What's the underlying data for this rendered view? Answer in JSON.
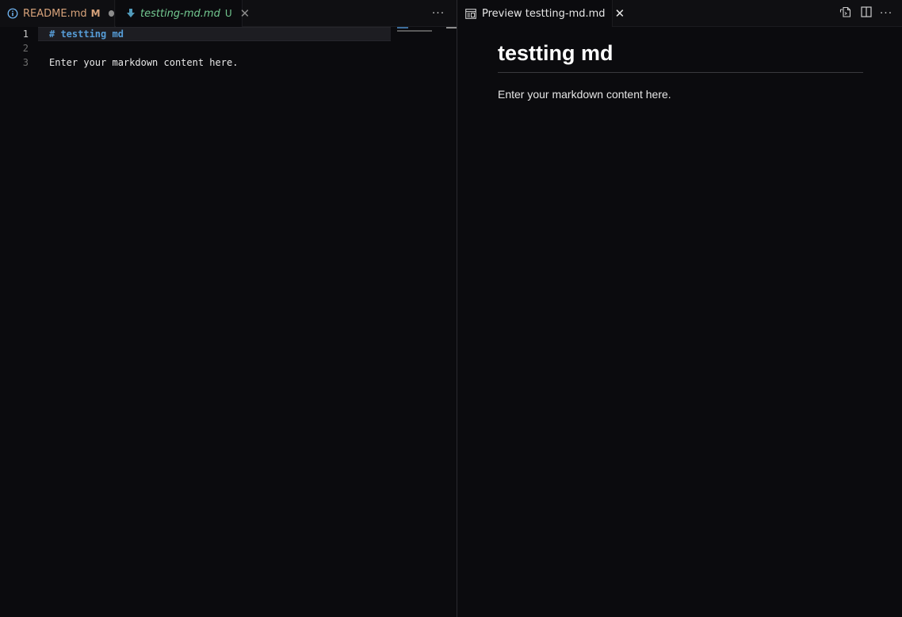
{
  "left_group": {
    "tabs": [
      {
        "label": "README.md",
        "status": "M",
        "icon": "info-icon",
        "dirty": true
      },
      {
        "label": "testting-md.md",
        "status": "U",
        "icon": "markdown-arrow-icon",
        "active": true
      }
    ],
    "more_label": "···"
  },
  "editor": {
    "lines": [
      {
        "number": "1",
        "text": "# testting md",
        "kind": "heading"
      },
      {
        "number": "2",
        "text": "",
        "kind": "plain"
      },
      {
        "number": "3",
        "text": "Enter your markdown content here.",
        "kind": "plain"
      }
    ]
  },
  "right_group": {
    "tab": {
      "label": "Preview testting-md.md",
      "icon": "preview-icon"
    },
    "more_label": "···"
  },
  "preview": {
    "heading": "testting md",
    "paragraph": "Enter your markdown content here."
  },
  "colors": {
    "modified": "#d7a27a",
    "untracked": "#73c991",
    "heading_token": "#569cd6",
    "background": "#0b0b0e"
  }
}
